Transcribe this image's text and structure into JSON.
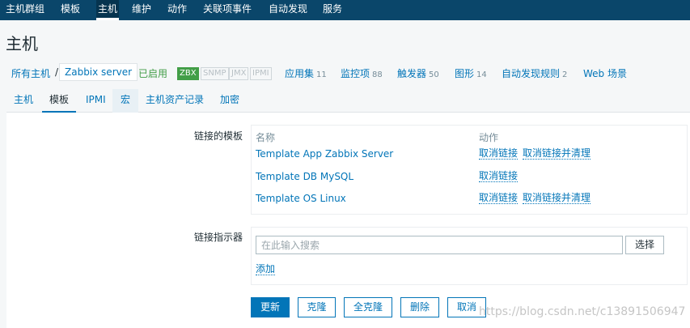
{
  "topnav": {
    "items": [
      "主机群组",
      "模板",
      "主机",
      "维护",
      "动作",
      "关联项事件",
      "自动发现",
      "服务"
    ],
    "active_index": 2
  },
  "page": {
    "title": "主机"
  },
  "breadcrumb": {
    "all_hosts": "所有主机",
    "separator": "/",
    "current": "Zabbix server",
    "status": "已启用",
    "availability": [
      {
        "label": "ZBX",
        "active": true
      },
      {
        "label": "SNMP",
        "active": false
      },
      {
        "label": "JMX",
        "active": false
      },
      {
        "label": "IPMI",
        "active": false
      }
    ],
    "links": [
      {
        "label": "应用集",
        "count": "11"
      },
      {
        "label": "监控项",
        "count": "88"
      },
      {
        "label": "触发器",
        "count": "50"
      },
      {
        "label": "图形",
        "count": "14"
      },
      {
        "label": "自动发现规则",
        "count": "2"
      },
      {
        "label": "Web 场景",
        "count": ""
      }
    ]
  },
  "tabs": {
    "items": [
      "主机",
      "模板",
      "IPMI",
      "宏",
      "主机资产记录",
      "加密"
    ],
    "active_index": 1
  },
  "form": {
    "linked_templates_label": "链接的模板",
    "col_name": "名称",
    "col_action": "动作",
    "templates": [
      {
        "name": "Template App Zabbix Server",
        "unlink": "取消链接",
        "unlink_clear": "取消链接并清理"
      },
      {
        "name": "Template DB MySQL",
        "unlink": "取消链接",
        "unlink_clear": ""
      },
      {
        "name": "Template OS Linux",
        "unlink": "取消链接",
        "unlink_clear": "取消链接并清理"
      }
    ],
    "link_new_label": "链接指示器",
    "search_placeholder": "在此输入搜索",
    "select_button": "选择",
    "add_link": "添加"
  },
  "buttons": {
    "update": "更新",
    "clone": "克隆",
    "full_clone": "全克隆",
    "delete": "删除",
    "cancel": "取消"
  },
  "watermark": "https://blog.csdn.net/c13891506947",
  "colors": {
    "nav_bg": "#0a466a",
    "link": "#0275b8",
    "enabled": "#429e47",
    "primary_button": "#0275b8"
  }
}
